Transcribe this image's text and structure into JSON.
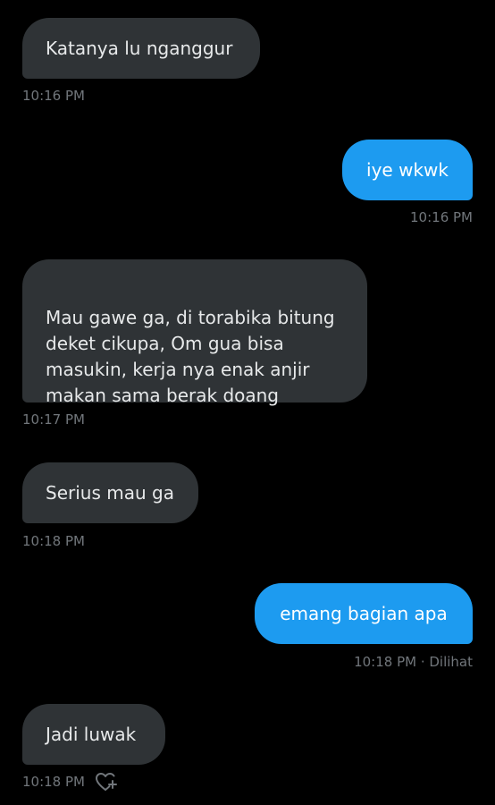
{
  "theme": {
    "background": "#000000",
    "incoming_bubble": "#2f3336",
    "outgoing_bubble": "#1d9bf0",
    "timestamp_color": "#71767b"
  },
  "messages": [
    {
      "direction": "incoming",
      "text": "Katanya lu nganggur",
      "time": "10:16 PM"
    },
    {
      "direction": "outgoing",
      "text": "iye wkwk",
      "time": "10:16 PM"
    },
    {
      "direction": "incoming",
      "text": "Mau gawe ga, di torabika bitung\ndeket cikupa, Om gua bisa\nmasukin, kerja nya enak anjir\nmakan sama berak doang",
      "time": "10:17 PM"
    },
    {
      "direction": "incoming",
      "text": "Serius mau ga",
      "time": "10:18 PM"
    },
    {
      "direction": "outgoing",
      "text": "emang bagian apa",
      "time": "10:18 PM · Dilihat"
    },
    {
      "direction": "incoming",
      "text": "Jadi luwak",
      "time": "10:18 PM",
      "reaction_icon": "heart-plus-icon"
    }
  ]
}
